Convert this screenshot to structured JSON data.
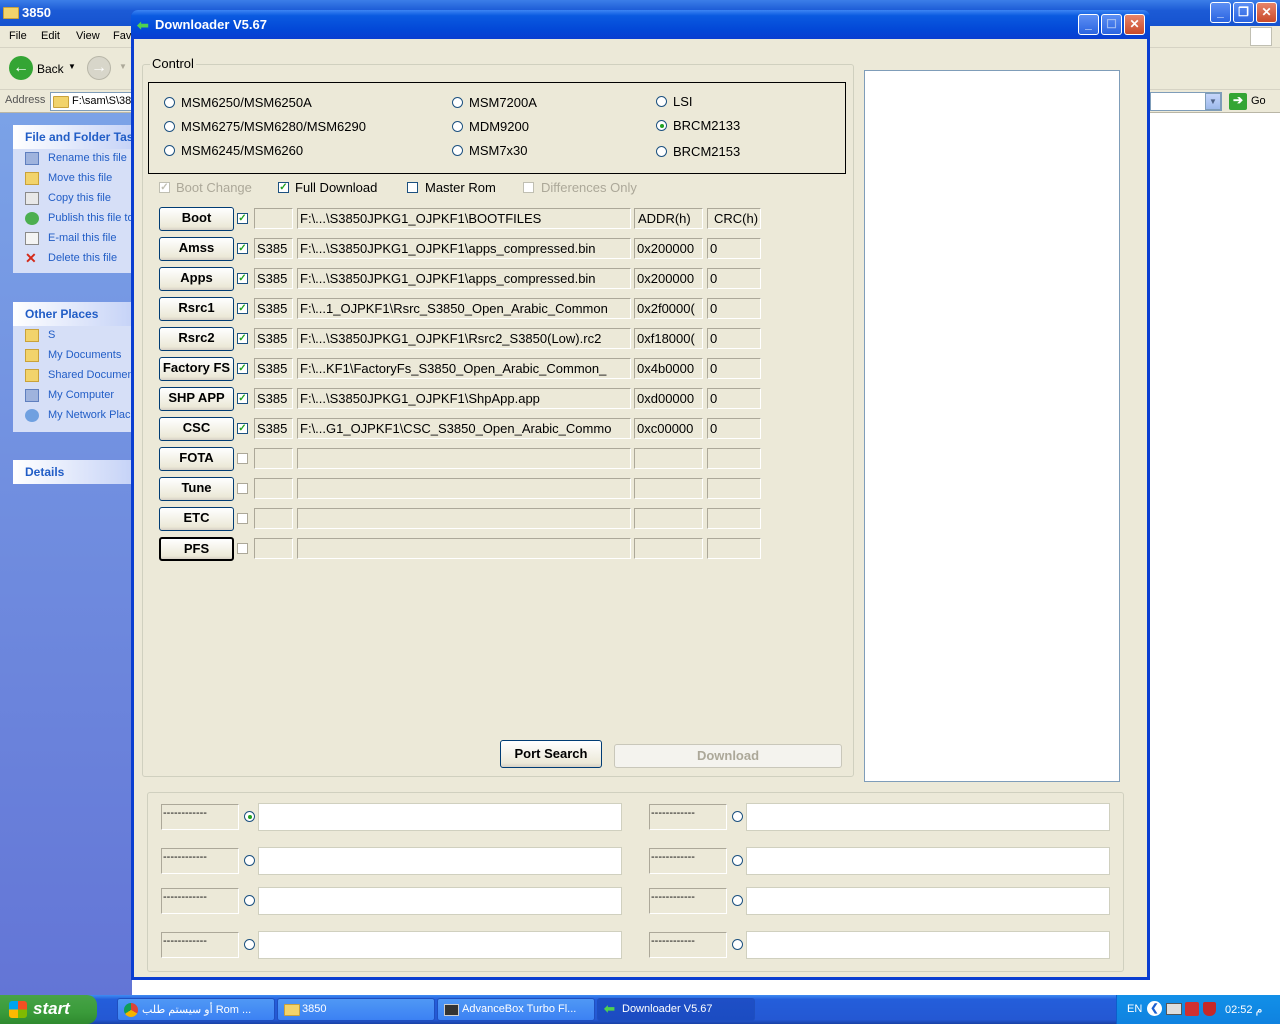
{
  "explorer": {
    "title": "3850",
    "menu": [
      "File",
      "Edit",
      "View",
      "Fav"
    ],
    "back_label": "Back",
    "address_label": "Address",
    "address_value": "F:\\sam\\S\\38",
    "go_label": "Go",
    "file_tasks_title": "File and Folder Tas",
    "file_tasks": [
      "Rename this file",
      "Move this file",
      "Copy this file",
      "Publish this file to",
      "E-mail this file",
      "Delete this file"
    ],
    "other_places_title": "Other Places",
    "other_places": [
      "S",
      "My Documents",
      "Shared Documen",
      "My Computer",
      "My Network Place"
    ],
    "details_title": "Details"
  },
  "dialog": {
    "title": "Downloader V5.67",
    "control_label": "Control",
    "models": [
      {
        "label": "MSM6250/MSM6250A",
        "selected": false
      },
      {
        "label": "MSM6275/MSM6280/MSM6290",
        "selected": false
      },
      {
        "label": "MSM6245/MSM6260",
        "selected": false
      },
      {
        "label": "MSM7200A",
        "selected": false
      },
      {
        "label": "MDM9200",
        "selected": false
      },
      {
        "label": "MSM7x30",
        "selected": false
      },
      {
        "label": "LSI",
        "selected": false
      },
      {
        "label": "BRCM2133",
        "selected": true
      },
      {
        "label": "BRCM2153",
        "selected": false
      }
    ],
    "options": [
      {
        "label": "Boot Change",
        "checked": true,
        "enabled": false
      },
      {
        "label": "Full Download",
        "checked": true,
        "enabled": true
      },
      {
        "label": "Master Rom",
        "checked": false,
        "enabled": true
      },
      {
        "label": "Differences Only",
        "checked": false,
        "enabled": false
      }
    ],
    "header_addr": "ADDR(h)",
    "header_crc": "CRC(h)",
    "rows": [
      {
        "button": "Boot",
        "checked": true,
        "model": "",
        "path": "F:\\...\\S3850JPKG1_OJPKF1\\BOOTFILES",
        "addr": "",
        "crc": ""
      },
      {
        "button": "Amss",
        "checked": true,
        "model": "S385",
        "path": "F:\\...\\S3850JPKG1_OJPKF1\\apps_compressed.bin",
        "addr": "0x200000",
        "crc": "0"
      },
      {
        "button": "Apps",
        "checked": true,
        "model": "S385",
        "path": "F:\\...\\S3850JPKG1_OJPKF1\\apps_compressed.bin",
        "addr": "0x200000",
        "crc": "0"
      },
      {
        "button": "Rsrc1",
        "checked": true,
        "model": "S385",
        "path": "F:\\...1_OJPKF1\\Rsrc_S3850_Open_Arabic_Common",
        "addr": "0x2f0000(",
        "crc": "0"
      },
      {
        "button": "Rsrc2",
        "checked": true,
        "model": "S385",
        "path": "F:\\...\\S3850JPKG1_OJPKF1\\Rsrc2_S3850(Low).rc2",
        "addr": "0xf18000(",
        "crc": "0"
      },
      {
        "button": "Factory FS",
        "checked": true,
        "model": "S385",
        "path": "F:\\...KF1\\FactoryFs_S3850_Open_Arabic_Common_",
        "addr": "0x4b0000",
        "crc": "0"
      },
      {
        "button": "SHP APP",
        "checked": true,
        "model": "S385",
        "path": "F:\\...\\S3850JPKG1_OJPKF1\\ShpApp.app",
        "addr": "0xd00000",
        "crc": "0"
      },
      {
        "button": "CSC",
        "checked": true,
        "model": "S385",
        "path": "F:\\...G1_OJPKF1\\CSC_S3850_Open_Arabic_Commo",
        "addr": "0xc00000",
        "crc": "0"
      },
      {
        "button": "FOTA",
        "checked": false,
        "model": "",
        "path": "",
        "addr": "",
        "crc": ""
      },
      {
        "button": "Tune",
        "checked": false,
        "model": "",
        "path": "",
        "addr": "",
        "crc": ""
      },
      {
        "button": "ETC",
        "checked": false,
        "model": "",
        "path": "",
        "addr": "",
        "crc": ""
      },
      {
        "button": "PFS",
        "checked": false,
        "model": "",
        "path": "",
        "addr": "",
        "crc": ""
      }
    ],
    "port_search_label": "Port Search",
    "download_label": "Download",
    "ports": [
      {
        "label": "------------",
        "selected": true
      },
      {
        "label": "------------",
        "selected": false
      },
      {
        "label": "------------",
        "selected": false
      },
      {
        "label": "------------",
        "selected": false
      },
      {
        "label": "------------",
        "selected": false
      },
      {
        "label": "------------",
        "selected": false
      },
      {
        "label": "------------",
        "selected": false
      },
      {
        "label": "------------",
        "selected": false
      }
    ]
  },
  "taskbar": {
    "start_label": "start",
    "items": [
      {
        "label": "أو سيستم طلب Rom ..."
      },
      {
        "label": "3850"
      },
      {
        "label": "AdvanceBox Turbo Fl..."
      },
      {
        "label": "Downloader V5.67"
      }
    ],
    "lang": "EN",
    "clock": "02:52 م"
  },
  "colors": {
    "accent": "#0a3ed1",
    "check": "#21a121"
  }
}
